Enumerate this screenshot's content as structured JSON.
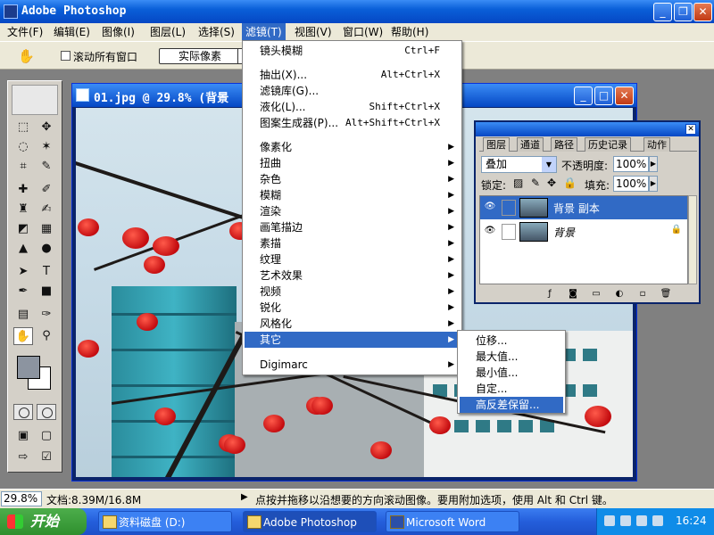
{
  "app": {
    "title": "Adobe Photoshop",
    "min": "_",
    "max": "❐",
    "close": "✕"
  },
  "menubar": [
    "文件(F)",
    "编辑(E)",
    "图像(I)",
    "图层(L)",
    "选择(S)",
    "滤镜(T)",
    "视图(V)",
    "窗口(W)",
    "帮助(H)"
  ],
  "options": {
    "scroll_all": "滚动所有窗口",
    "actual_pixels": "实际像素"
  },
  "document": {
    "title": "01.jpg @ 29.8% (背景"
  },
  "filter_menu": {
    "top": [
      {
        "label": "镜头模糊",
        "shortcut": "Ctrl+F"
      }
    ],
    "group2": [
      {
        "label": "抽出(X)...",
        "shortcut": "Alt+Ctrl+X"
      },
      {
        "label": "滤镜库(G)...",
        "shortcut": ""
      },
      {
        "label": "液化(L)...",
        "shortcut": "Shift+Ctrl+X"
      },
      {
        "label": "图案生成器(P)...",
        "shortcut": "Alt+Shift+Ctrl+X"
      }
    ],
    "group3": [
      "像素化",
      "扭曲",
      "杂色",
      "模糊",
      "渲染",
      "画笔描边",
      "素描",
      "纹理",
      "艺术效果",
      "视频",
      "锐化",
      "风格化",
      "其它"
    ],
    "highlight": "其它",
    "group4": [
      "Digimarc"
    ]
  },
  "submenu": {
    "items": [
      "位移...",
      "最大值...",
      "最小值...",
      "自定...",
      "高反差保留..."
    ],
    "highlight": "高反差保留..."
  },
  "layers": {
    "tabs": [
      "图层",
      "通道",
      "路径",
      "历史记录",
      "动作"
    ],
    "blend_mode": "叠加",
    "opacity_label": "不透明度:",
    "opacity": "100%",
    "lock_label": "锁定:",
    "fill_label": "填充:",
    "fill": "100%",
    "rows": [
      {
        "name": "背景 副本",
        "selected": true
      },
      {
        "name": "背景",
        "selected": false
      }
    ]
  },
  "status": {
    "zoom": "29.8%",
    "doc": "文档:8.39M/16.8M",
    "hint": "点按并拖移以沿想要的方向滚动图像。要用附加选项，使用 Alt 和 Ctrl 键。"
  },
  "taskbar": {
    "start": "开始",
    "tasks": [
      "资料磁盘 (D:)",
      "Adobe Photoshop",
      "Microsoft Word"
    ],
    "time": "16:24"
  }
}
